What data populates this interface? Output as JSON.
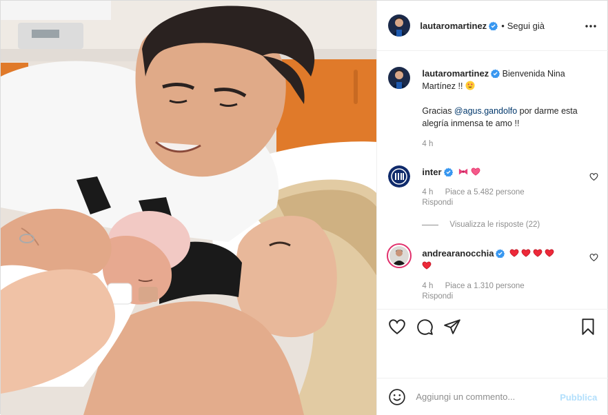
{
  "post": {
    "author": "lautaromartinez",
    "follow_status": "Segui già",
    "separator": "•"
  },
  "caption": {
    "username": "lautaromartinez",
    "line1": "Bienvenida Nina Martínez !!",
    "line2_prefix": "Gracias ",
    "mention": "@agus.gandolfo",
    "line2_suffix": " por darme esta alegría inmensa te amo !!",
    "time": "4 h"
  },
  "comments": [
    {
      "username": "inter",
      "time": "4 h",
      "likes": "Piace a 5.482 persone",
      "reply": "Rispondi",
      "view_replies": "Visualizza le risposte (22)"
    },
    {
      "username": "andrearanocchia",
      "time": "4 h",
      "likes": "Piace a 1.310 persone",
      "reply": "Rispondi"
    }
  ],
  "add_comment": {
    "placeholder": "Aggiungi un commento...",
    "publish_label": "Pubblica"
  },
  "icons": {
    "more": "more-options-icon",
    "like": "heart-icon",
    "comment": "comment-icon",
    "share": "share-icon",
    "save": "bookmark-icon",
    "emoji": "smiley-icon",
    "verified": "verified-badge-icon"
  },
  "colors": {
    "verified_blue": "#3897f0",
    "heart_red": "#ed4956",
    "bow_pink": "#e8407a",
    "publish_disabled": "#b2dffc",
    "meta_gray": "#8e8e8e"
  }
}
